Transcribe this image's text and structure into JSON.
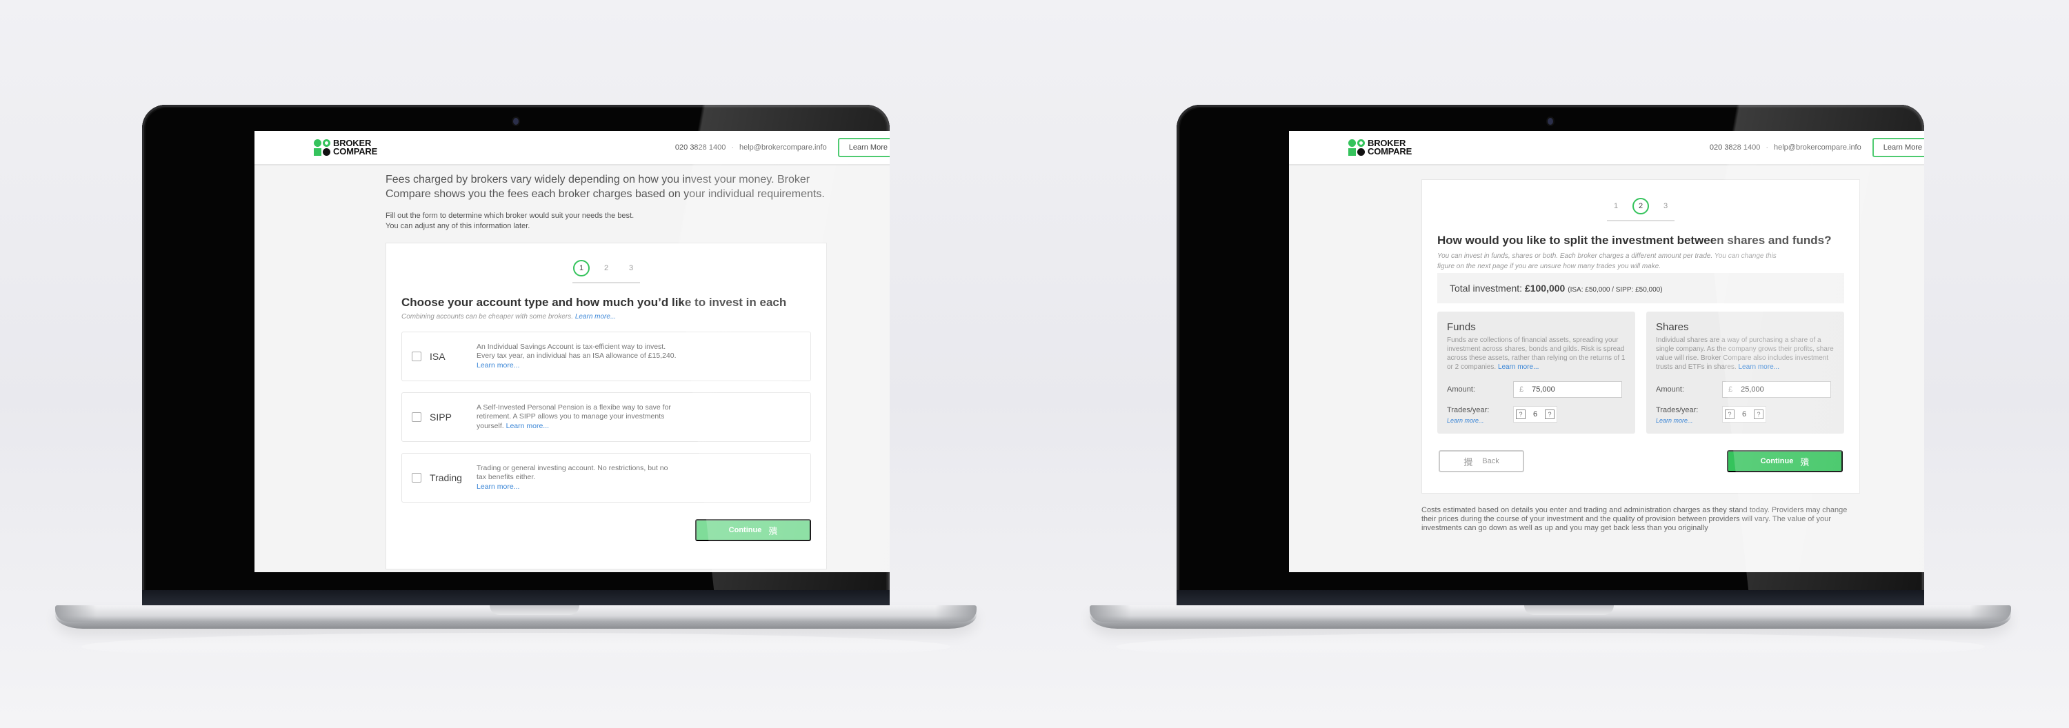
{
  "brand": {
    "name_line1": "BROKER",
    "name_line2": "COMPARE",
    "accent_color": "#35c35c",
    "link_color": "#3b86d6"
  },
  "header": {
    "phone": "020 3828 1400",
    "separator": "·",
    "email": "help@brokercompare.info",
    "learn_more_label": "Learn More"
  },
  "step1": {
    "intro_lead": "Fees charged by brokers vary widely depending on how you invest your money. Broker Compare shows you the fees each broker charges based on your individual requirements.",
    "intro_sub_1": "Fill out the form to determine which broker would suit your needs the best.",
    "intro_sub_2": "You can adjust any of this information later.",
    "steps": [
      "1",
      "2",
      "3"
    ],
    "active_step": 1,
    "title": "Choose your account type and how much you’d like to invest in each",
    "hint": "Combining accounts can be cheaper with some brokers.",
    "hint_link": "Learn more...",
    "accounts": [
      {
        "name": "ISA",
        "checked": false,
        "description": "An Individual Savings Account is tax-efficient way to invest. Every tax year, an individual has an ISA allowance of £15,240.",
        "link": "Learn more..."
      },
      {
        "name": "SIPP",
        "checked": false,
        "description": "A Self-Invested Personal Pension is a flexibe way to save for retirement. A SIPP allows you to manage your investments yourself.",
        "link": "Learn more..."
      },
      {
        "name": "Trading",
        "checked": false,
        "description": "Trading or general investing account. No restrictions, but no tax benefits either.",
        "link": "Learn more..."
      }
    ],
    "continue_label": "Continue",
    "continue_icon": "殨",
    "continue_enabled": false
  },
  "step2": {
    "steps": [
      "1",
      "2",
      "3"
    ],
    "active_step": 2,
    "title": "How would you like to split the investment between shares and funds?",
    "hint": "You can invest in funds, shares or both. Each broker charges a different amount per trade. You can change this figure on the next page if you are unsure how many trades you will make.",
    "total_label": "Total investment:",
    "total_value": "£100,000",
    "total_breakdown": "(ISA: £50,000 / SIPP: £50,000)",
    "panels": [
      {
        "title": "Funds",
        "description": "Funds are collections of financial assets, spreading your investment across shares, bonds and gilds. Risk is spread across these assets, rather than relying on the returns of 1 or 2 companies.",
        "link": "Learn more...",
        "amount_label": "Amount:",
        "currency": "£",
        "amount": "75,000",
        "trades_label": "Trades/year:",
        "trades_link": "Learn more...",
        "trades": "6",
        "stepper_glyph": "?"
      },
      {
        "title": "Shares",
        "description": "Individual shares are a way of purchasing a share of a single company. As the company grows their profits, share value will rise. Broker Compare also includes investment trusts and ETFs in shares.",
        "link": "Learn more...",
        "amount_label": "Amount:",
        "currency": "£",
        "amount": "25,000",
        "trades_label": "Trades/year:",
        "trades_link": "Learn more...",
        "trades": "6",
        "stepper_glyph": "?"
      }
    ],
    "back_label": "Back",
    "back_icon": "攪",
    "continue_label": "Continue",
    "continue_icon": "殨",
    "disclaimer": "Costs estimated based on details you enter and trading and administration charges as they stand today. Providers may change their prices during the course of your investment and the quality of provision between providers will vary. The value of your investments can go down as well as up and you may get back less than you originally"
  }
}
